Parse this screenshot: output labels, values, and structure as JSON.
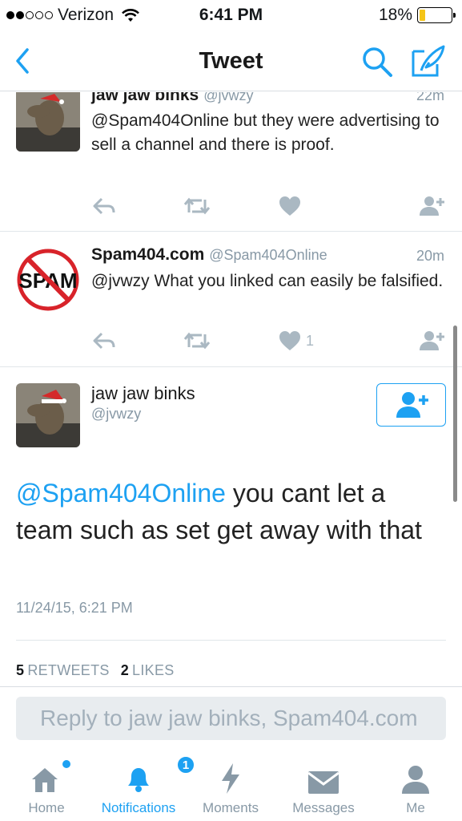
{
  "status_bar": {
    "carrier": "Verizon",
    "time": "6:41 PM",
    "battery_percent": "18%",
    "battery_level": 0.18,
    "signal_bars_filled": 2,
    "signal_bars_total": 5
  },
  "nav": {
    "title": "Tweet",
    "back_icon": "chevron-left-icon",
    "search_icon": "search-icon",
    "compose_icon": "compose-icon",
    "accent_color": "#1da1f2"
  },
  "tweets": [
    {
      "name": "jaw jaw binks",
      "handle": "@jvwzy",
      "time_ago": "22m",
      "text": "@Spam404Online but they were advertising to sell a channel and there is proof.",
      "likes": ""
    },
    {
      "name": "Spam404.com",
      "handle": "@Spam404Online",
      "time_ago": "20m",
      "text": "@jvwzy What you linked can easily be falsified.",
      "likes": "1",
      "avatar_text": "SPAM"
    }
  ],
  "main_tweet": {
    "name": "jaw jaw binks",
    "handle": "@jvwzy",
    "mention": "@Spam404Online",
    "text": " you cant let a team such as set get away with that",
    "date": "11/24/15, 6:21 PM",
    "retweets_count": "5",
    "retweets_label": "RETWEETS",
    "likes_count": "2",
    "likes_label": "LIKES"
  },
  "reply": {
    "placeholder": "Reply to jaw jaw binks, Spam404.com"
  },
  "tabs": [
    {
      "label": "Home",
      "icon": "home-icon",
      "active": false
    },
    {
      "label": "Notifications",
      "icon": "bell-icon",
      "active": true,
      "badge": "1"
    },
    {
      "label": "Moments",
      "icon": "lightning-icon",
      "active": false
    },
    {
      "label": "Messages",
      "icon": "envelope-icon",
      "active": false
    },
    {
      "label": "Me",
      "icon": "person-icon",
      "active": false
    }
  ]
}
